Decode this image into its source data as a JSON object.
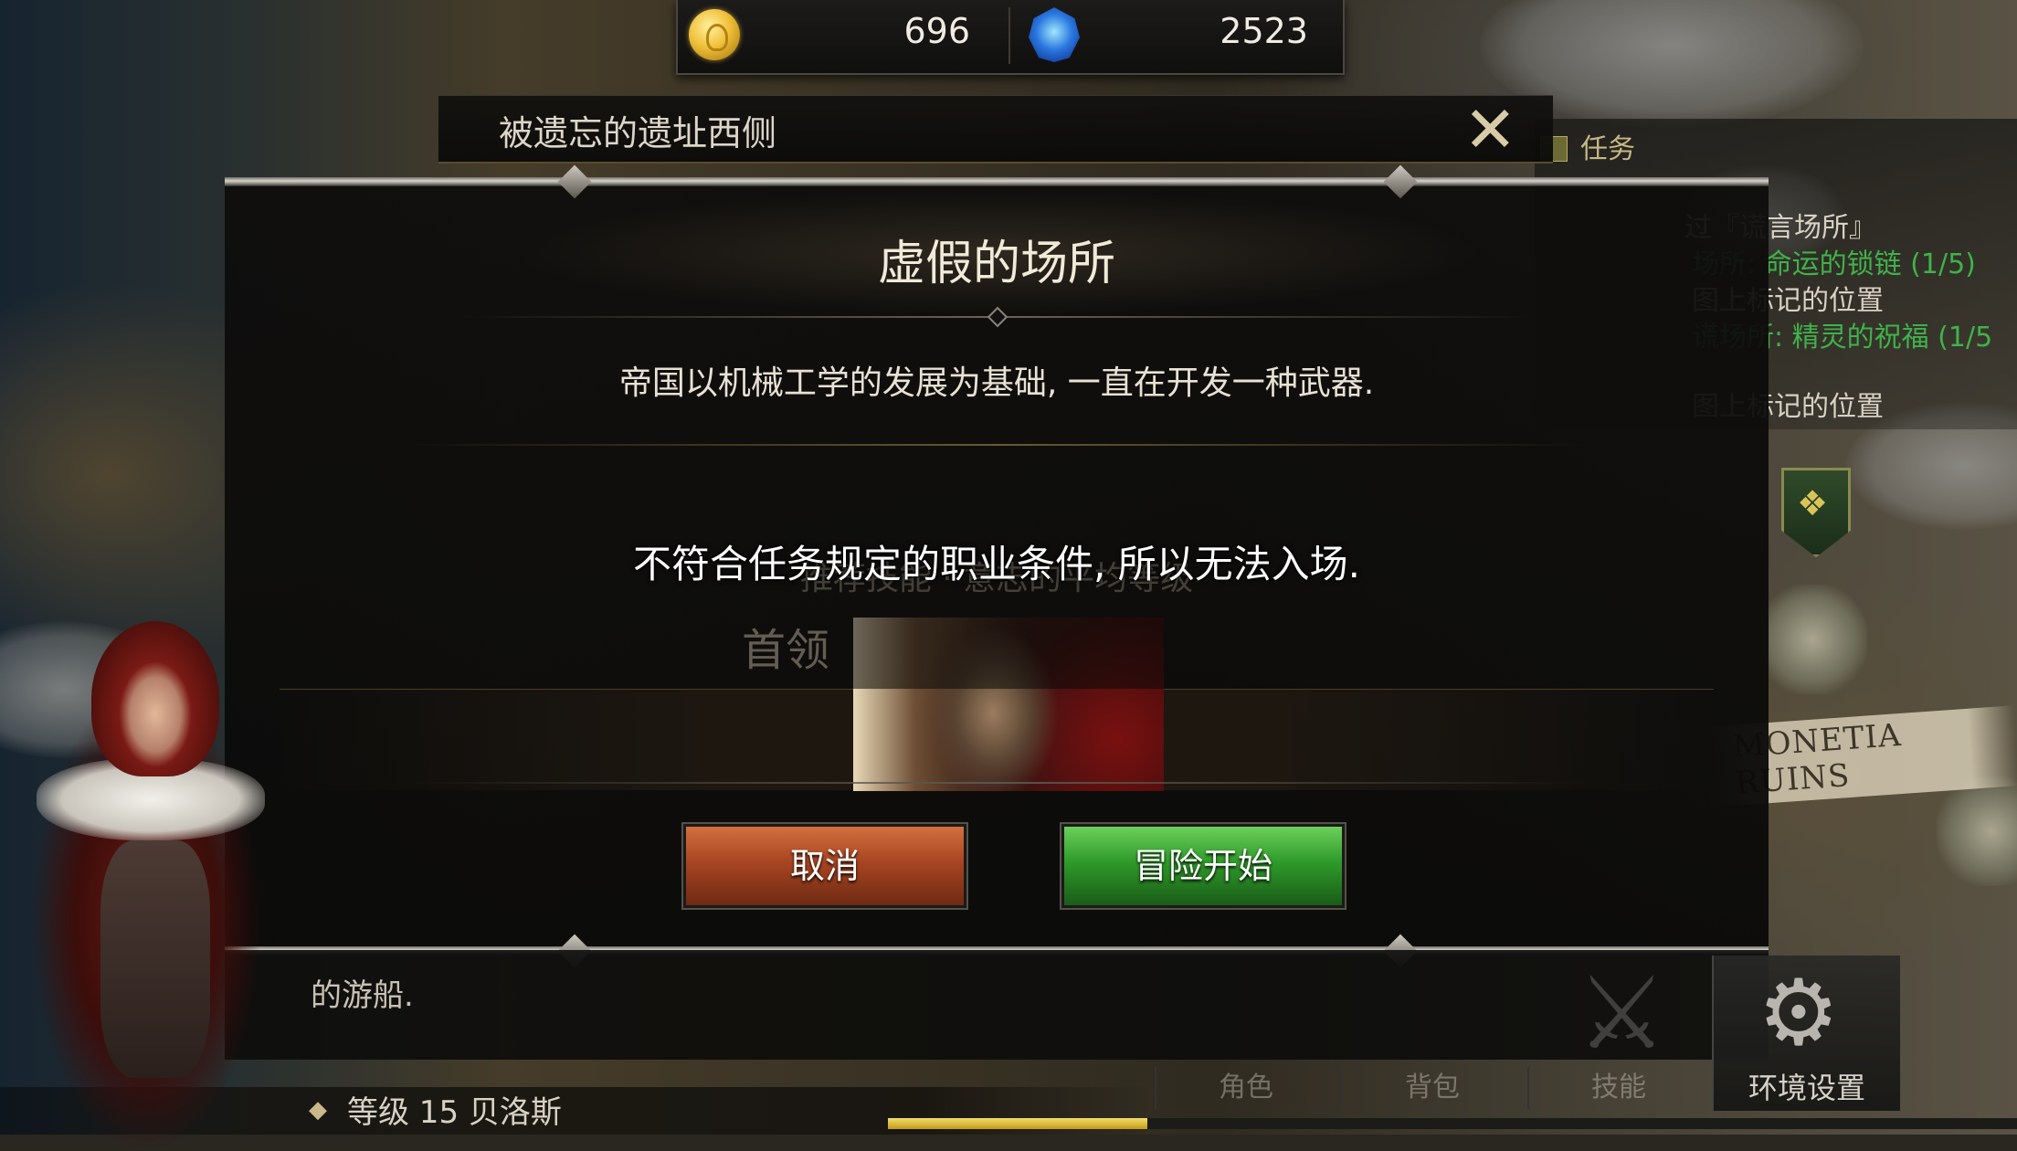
{
  "currency": {
    "gold": "696",
    "gems": "2523",
    "gold_icon": "gold-coin-icon",
    "gem_icon": "blue-gem-icon"
  },
  "header": {
    "location": "被遗忘的遗址西侧",
    "close_glyph": "✕"
  },
  "quest_panel": {
    "title": "任务",
    "lines": [
      {
        "text": "过『谎言场所』",
        "color": "white"
      },
      {
        "text": "场所: 命运的锁链 (1/5)",
        "color": "green"
      },
      {
        "text": "图上标记的位置",
        "color": "white"
      },
      {
        "text": "谎场所: 精灵的祝福 (1/5",
        "color": "green"
      },
      {
        "text": "图上标记的位置",
        "color": "white"
      }
    ]
  },
  "map": {
    "ruins_label": "MONETIA RUINS"
  },
  "dialog": {
    "title": "虚假的场所",
    "description": "帝国以机械工学的发展为基础, 一直在开发一种武器.",
    "warning": "不符合任务规定的职业条件, 所以无法入场.",
    "ghost_text": "推荐技能 · 意志的平均等级",
    "boss_label": "首领",
    "cancel_label": "取消",
    "start_label": "冒险开始"
  },
  "bottom": {
    "text": "的游船.",
    "level_text": "等级 15 贝洛斯",
    "tabs": [
      "角色",
      "背包",
      "技能"
    ],
    "settings_label": "环境设置",
    "xp_progress": 0.23
  },
  "colors": {
    "cancel": "#a84522",
    "start": "#2f9a2a",
    "quest_green": "#3fb24a",
    "xp": "#e2c23a"
  }
}
